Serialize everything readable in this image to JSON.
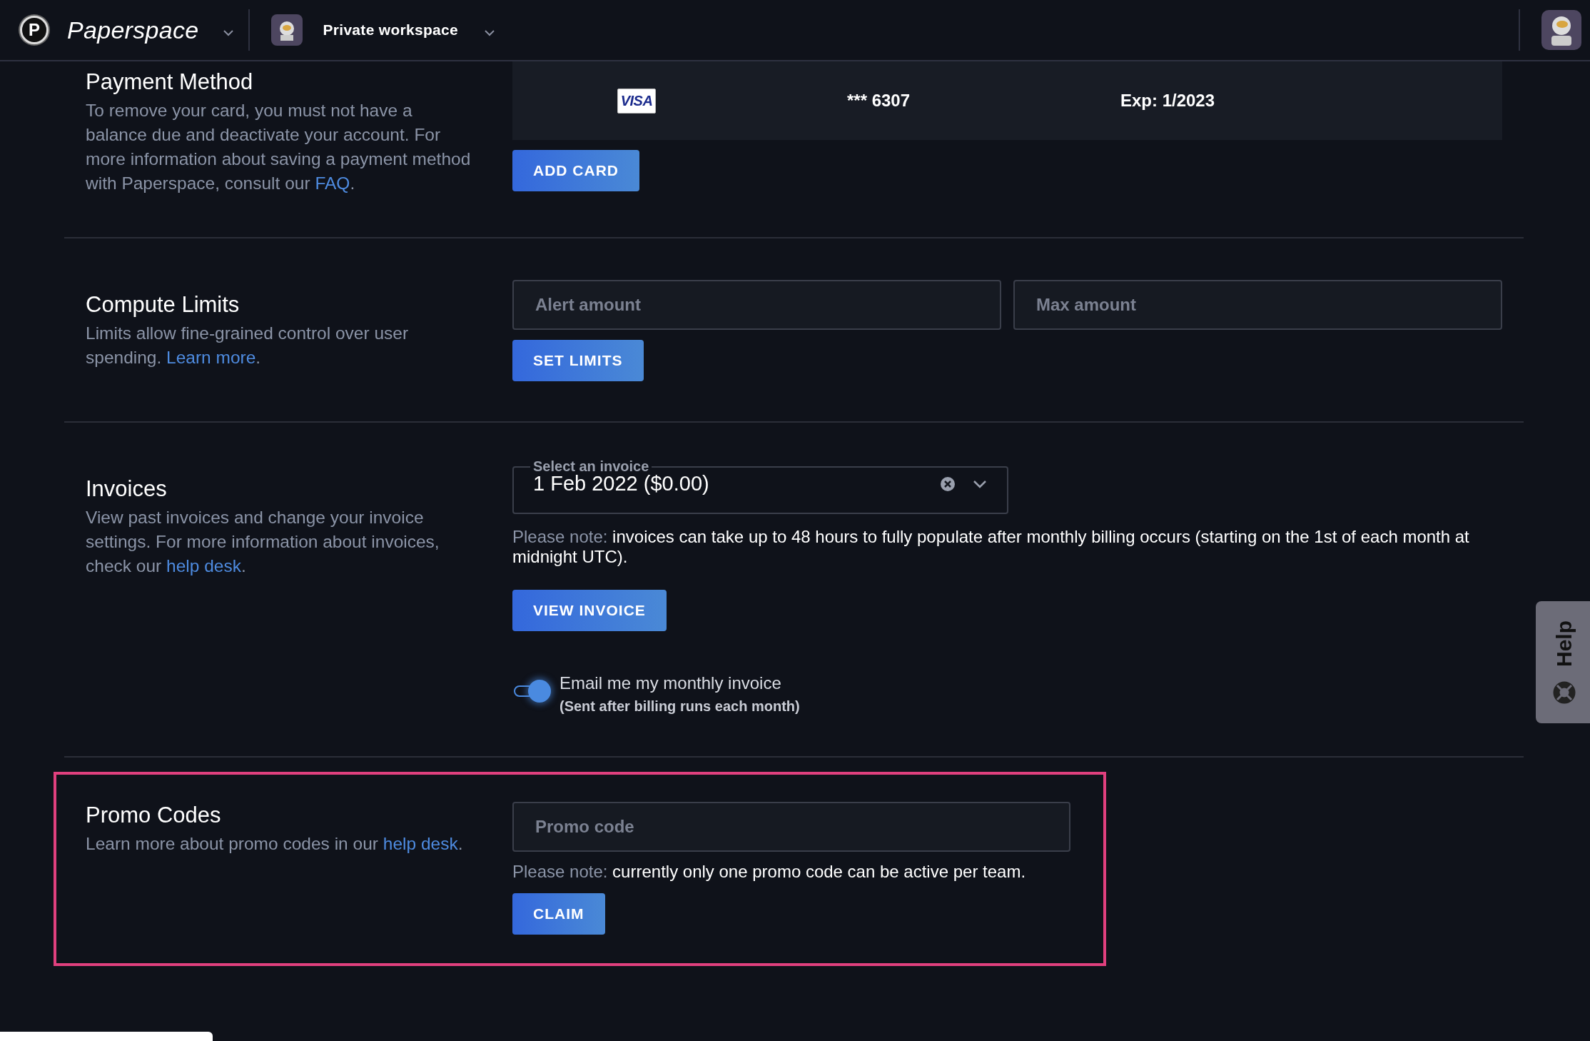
{
  "header": {
    "logo_letter": "P",
    "brand": "Paperspace",
    "workspace": "Private workspace"
  },
  "sections": [
    {
      "kind": "payment",
      "highlighted": false,
      "title": "Payment Method",
      "description": "To remove your card, you must not have a balance due and deactivate your account. For more information about saving a payment method with Paperspace, consult our ",
      "link": "FAQ",
      "after_link": ".",
      "card": {
        "brand": "VISA",
        "number": "*** 6307",
        "expiry": "Exp: 1/2023"
      },
      "button": "ADD CARD"
    },
    {
      "kind": "limits",
      "highlighted": false,
      "title": "Compute Limits",
      "description": "Limits allow fine-grained control over user spending. ",
      "link": "Learn more",
      "after_link": ".",
      "fields": [
        {
          "placeholder": "Alert amount"
        },
        {
          "placeholder": "Max amount"
        }
      ],
      "button": "SET LIMITS"
    },
    {
      "kind": "invoices",
      "highlighted": false,
      "title": "Invoices",
      "description": "View past invoices and change your invoice settings. For more information about invoices, check our ",
      "link": "help desk",
      "after_link": ".",
      "select": {
        "label": "Select an invoice",
        "value": "1 Feb 2022 ($0.00)"
      },
      "note_label": "Please note:",
      "note": "invoices can take up to 48 hours to fully populate after monthly billing occurs (starting on the 1st of each month at midnight UTC).",
      "button": "VIEW INVOICE",
      "toggle": {
        "label": "Email me my monthly invoice",
        "sublabel": "(Sent after billing runs each month)",
        "on": true
      }
    },
    {
      "kind": "promo",
      "highlighted": true,
      "title": "Promo Codes",
      "description": "Learn more about promo codes in our ",
      "link": "help desk",
      "after_link": ".",
      "field": {
        "placeholder": "Promo code"
      },
      "note_label": "Please note:",
      "note": "currently only one promo code can be active per team.",
      "button": "CLAIM"
    }
  ],
  "help": {
    "label": "Help"
  }
}
